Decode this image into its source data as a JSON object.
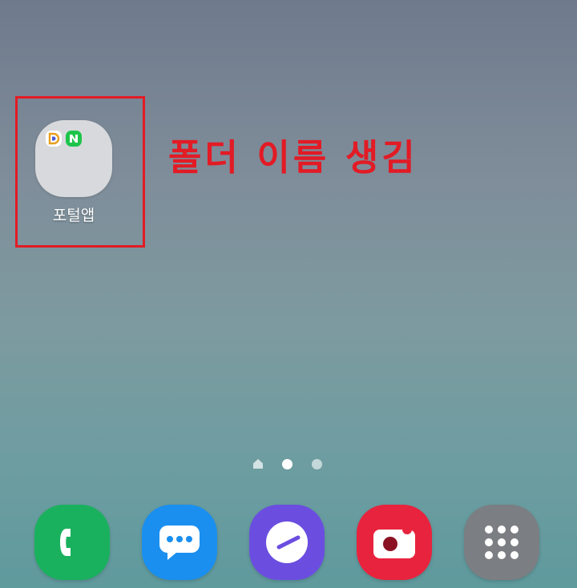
{
  "folder": {
    "name": "포털앱",
    "apps": [
      {
        "icon": "daum-app-icon",
        "letter": "D",
        "color": "#4a5bd8"
      },
      {
        "icon": "naver-app-icon",
        "letter": "N",
        "color": "#1ec44a"
      }
    ]
  },
  "annotation": {
    "text": "폴더 이름 생김",
    "color": "#e21b25"
  },
  "page_indicator": {
    "pages": 2,
    "current": 1,
    "has_home": true
  },
  "dock": {
    "apps": [
      {
        "icon": "phone-icon",
        "color": "#1ab15e"
      },
      {
        "icon": "messages-icon",
        "color": "#1a8ff0"
      },
      {
        "icon": "internet-browser-icon",
        "color": "#6b4ee0"
      },
      {
        "icon": "camera-icon",
        "color": "#e8233e"
      },
      {
        "icon": "apps-grid-icon",
        "color": "#7b7e82"
      }
    ]
  }
}
